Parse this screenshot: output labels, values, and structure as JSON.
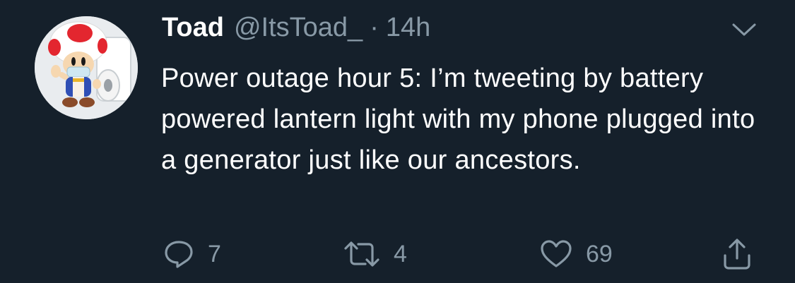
{
  "tweet": {
    "display_name": "Toad",
    "handle": "@ItsToad_",
    "separator": "·",
    "time": "14h",
    "text": "Power outage hour 5: I’m tweeting by battery powered lantern light with my phone plugged into a generator just like our ancestors.",
    "avatar_icon": "toad-avatar",
    "menu_icon": "chevron-down-icon"
  },
  "actions": {
    "reply": {
      "icon": "reply-icon",
      "count": "7"
    },
    "retweet": {
      "icon": "retweet-icon",
      "count": "4"
    },
    "like": {
      "icon": "heart-icon",
      "count": "69"
    },
    "share": {
      "icon": "share-icon"
    }
  },
  "colors": {
    "background": "#15202b",
    "primary_text": "#ffffff",
    "secondary_text": "#8899a6"
  }
}
